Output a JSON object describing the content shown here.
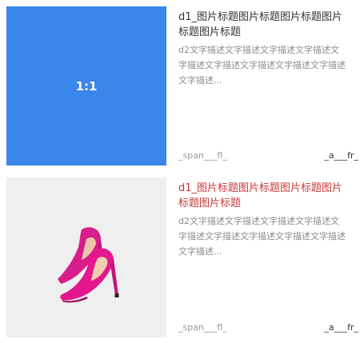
{
  "items": [
    {
      "thumb_label": "1:1",
      "title": "d1_图片标题图片标题图片标题图片标题图片标题",
      "desc": "d2文字描述文字描述文字描述文字描述文字描述文字描述文字描述文字描述文字描述文字描述...",
      "span_fl": "_span___fl_",
      "a_fr": "_a___fr_"
    },
    {
      "image": "pink-high-heels",
      "title": "d1_图片标题图片标题图片标题图片标题图片标题",
      "desc": "d2文字描述文字描述文字描述文字描述文字描述文字描述文字描述文字描述文字描述文字描述...",
      "span_fl": "_span___fl_",
      "a_fr": "_a___fr_"
    }
  ],
  "colors": {
    "thumb_blue": "#3a86ea",
    "thumb_grey": "#efefef",
    "title_active": "#c6383a",
    "title": "#333333",
    "desc": "#8c8c8c"
  }
}
